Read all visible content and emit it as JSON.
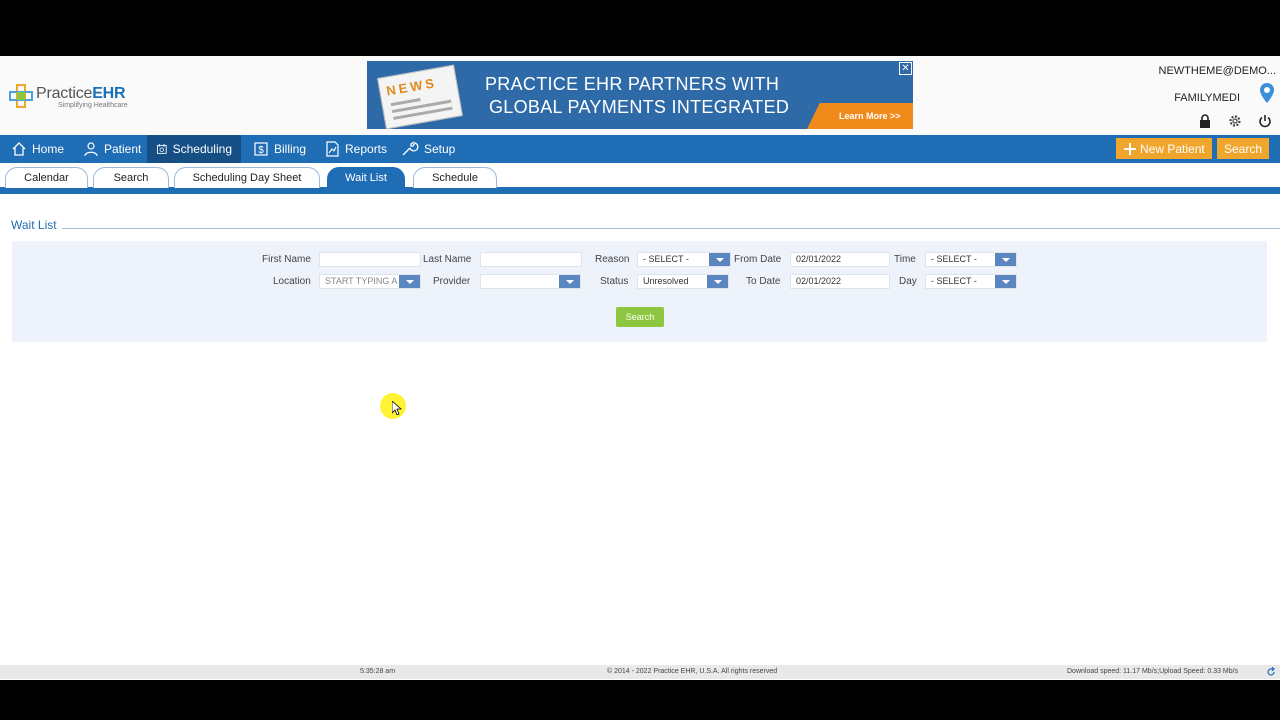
{
  "header": {
    "logo_brand_a": "Practice",
    "logo_brand_b": "EHR",
    "logo_tagline": "Simplifying Healthcare",
    "banner": {
      "news_label": "NEWS",
      "line1": "PRACTICE EHR PARTNERS WITH",
      "line2": "GLOBAL PAYMENTS INTEGRATED",
      "cta": "Learn More >>",
      "close": "✕"
    },
    "user_email": "NEWTHEME@DEMO...",
    "practice_name": "FAMILYMEDI",
    "icons": [
      "lock-icon",
      "gear-icon",
      "power-icon"
    ]
  },
  "nav": {
    "items": [
      {
        "label": "Home",
        "icon": "home-icon"
      },
      {
        "label": "Patient",
        "icon": "user-icon"
      },
      {
        "label": "Scheduling",
        "icon": "calendar-icon",
        "active": true
      },
      {
        "label": "Billing",
        "icon": "dollar-icon"
      },
      {
        "label": "Reports",
        "icon": "chart-icon"
      },
      {
        "label": "Setup",
        "icon": "wrench-icon"
      }
    ],
    "new_patient": "New Patient",
    "search": "Search"
  },
  "subtabs": [
    "Calendar",
    "Search",
    "Scheduling Day Sheet",
    "Wait List",
    "Schedule"
  ],
  "active_subtab": "Wait List",
  "section_title": "Wait List",
  "form": {
    "first_name_label": "First Name",
    "first_name_value": "",
    "last_name_label": "Last Name",
    "last_name_value": "",
    "reason_label": "Reason",
    "reason_value": "- SELECT -",
    "from_date_label": "From Date",
    "from_date_value": "02/01/2022",
    "time_label": "Time",
    "time_value": "- SELECT -",
    "location_label": "Location",
    "location_placeholder": "START TYPING A L",
    "provider_label": "Provider",
    "provider_value": "",
    "status_label": "Status",
    "status_value": "Unresolved",
    "to_date_label": "To Date",
    "to_date_value": "02/01/2022",
    "day_label": "Day",
    "day_value": "- SELECT -",
    "search_button": "Search"
  },
  "footer": {
    "time": "5:35:28 am",
    "copyright": "© 2014 - 2022 Practice EHR, U.S.A. All rights reserved",
    "speed": "Download speed: 11.17 Mb/s;Upload Speed: 0.33 Mb/s"
  },
  "colors": {
    "brand_blue": "#1f6db5",
    "nav_active": "#164f86",
    "orange": "#f0a62c",
    "green": "#8dc63f",
    "panel": "#eef3fb"
  }
}
